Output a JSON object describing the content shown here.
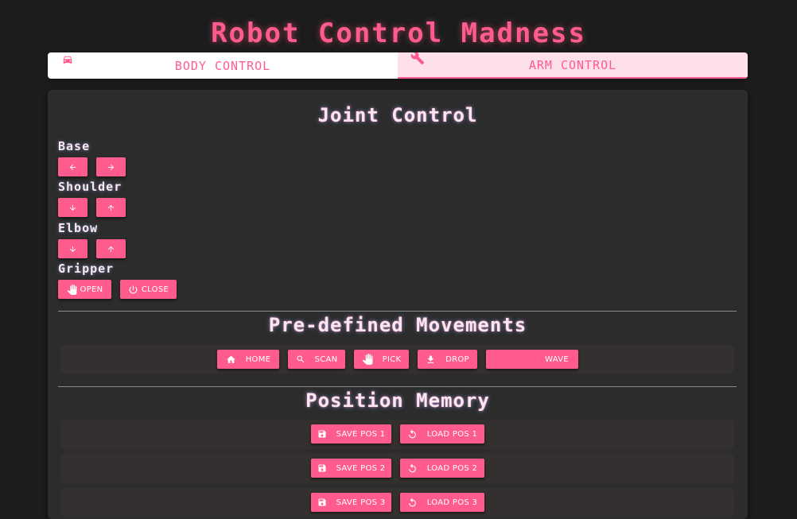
{
  "app": {
    "title": "Robot Control Madness"
  },
  "tabs": [
    {
      "label": "BODY CONTROL",
      "icon": "car-icon"
    },
    {
      "label": "ARM CONTROL",
      "icon": "wrench-icon",
      "active": true
    }
  ],
  "joint_control": {
    "title": "Joint Control",
    "joints": [
      {
        "label": "Base",
        "buttons": [
          "arrow-left-icon",
          "arrow-right-icon"
        ]
      },
      {
        "label": "Shoulder",
        "buttons": [
          "arrow-down-icon",
          "arrow-up-icon"
        ]
      },
      {
        "label": "Elbow",
        "buttons": [
          "arrow-down-icon",
          "arrow-up-icon"
        ]
      },
      {
        "label": "Gripper",
        "open_label": "OPEN",
        "close_label": "CLOSE"
      }
    ]
  },
  "predefined": {
    "title": "Pre-defined Movements",
    "buttons": [
      {
        "label": "HOME",
        "icon": "home-icon"
      },
      {
        "label": "SCAN",
        "icon": "search-icon"
      },
      {
        "label": "PICK",
        "icon": "hand-icon"
      },
      {
        "label": "DROP",
        "icon": "download-icon"
      },
      {
        "label": "WAVE",
        "icon": ""
      }
    ]
  },
  "memory": {
    "title": "Position Memory",
    "rows": [
      {
        "save_label": "SAVE POS 1",
        "load_label": "LOAD POS 1"
      },
      {
        "save_label": "SAVE POS 2",
        "load_label": "LOAD POS 2"
      },
      {
        "save_label": "SAVE POS 3",
        "load_label": "LOAD POS 3"
      }
    ]
  },
  "colors": {
    "accent": "#ff5c8d",
    "background": "#1c1c1c",
    "panel": "#2c2c2c",
    "tab_active_bg": "#fde0ea"
  }
}
